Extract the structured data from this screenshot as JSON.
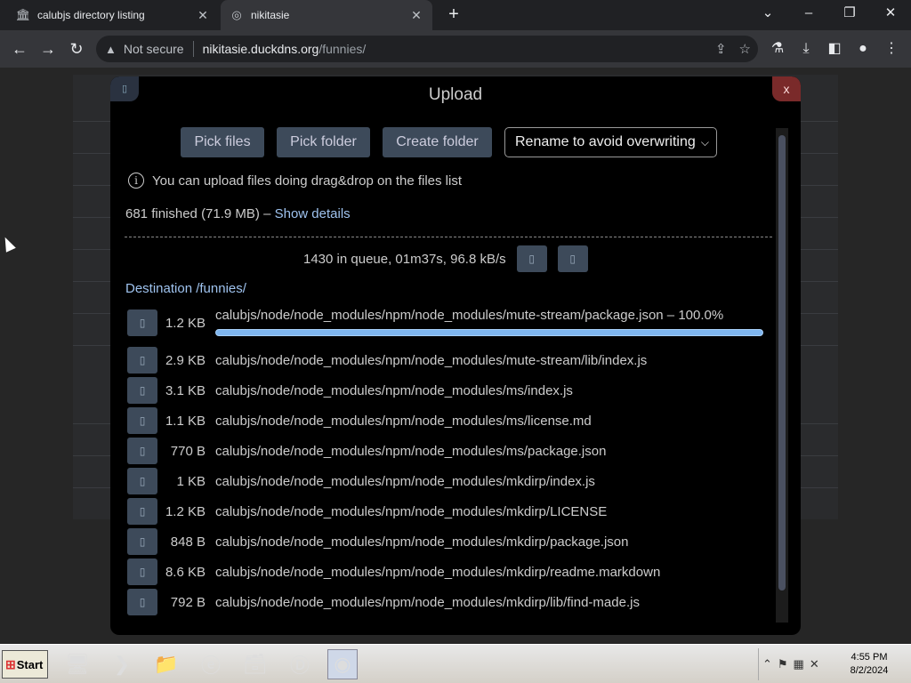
{
  "browser": {
    "tabs": [
      {
        "title": "calubjs directory listing",
        "icon": "bank-icon"
      },
      {
        "title": "nikitasie",
        "icon": "globe-icon"
      }
    ],
    "address": {
      "security": "Not secure",
      "host": "nikitasie.duckdns.org",
      "path": "/funnies/"
    }
  },
  "modal": {
    "title": "Upload",
    "close_label": "x",
    "buttons": {
      "pick_files": "Pick files",
      "pick_folder": "Pick folder",
      "create_folder": "Create folder"
    },
    "rename_select": "Rename to avoid overwriting",
    "tip": "You can upload files doing drag&drop on the files list",
    "finished": "681 finished (71.9 MB) –",
    "show_details": "Show details",
    "queue": "1430 in queue, 01m37s, 96.8 kB/s",
    "destination": "Destination /funnies/",
    "files": [
      {
        "size": "1.2 KB",
        "path": "calubjs/node/node_modules/npm/node_modules/mute-stream/package.json  – 100.0%",
        "progress": 1.0
      },
      {
        "size": "2.9 KB",
        "path": "calubjs/node/node_modules/npm/node_modules/mute-stream/lib/index.js"
      },
      {
        "size": "3.1 KB",
        "path": "calubjs/node/node_modules/npm/node_modules/ms/index.js"
      },
      {
        "size": "1.1 KB",
        "path": "calubjs/node/node_modules/npm/node_modules/ms/license.md"
      },
      {
        "size": "770 B",
        "path": "calubjs/node/node_modules/npm/node_modules/ms/package.json"
      },
      {
        "size": "1 KB",
        "path": "calubjs/node/node_modules/npm/node_modules/mkdirp/index.js"
      },
      {
        "size": "1.2 KB",
        "path": "calubjs/node/node_modules/npm/node_modules/mkdirp/LICENSE"
      },
      {
        "size": "848 B",
        "path": "calubjs/node/node_modules/npm/node_modules/mkdirp/package.json"
      },
      {
        "size": "8.6 KB",
        "path": "calubjs/node/node_modules/npm/node_modules/mkdirp/readme.markdown"
      },
      {
        "size": "792 B",
        "path": "calubjs/node/node_modules/npm/node_modules/mkdirp/lib/find-made.js"
      }
    ]
  },
  "taskbar": {
    "start_label": "Start",
    "clock_time": "4:55 PM",
    "clock_date": "8/2/2024"
  },
  "colors": {
    "accent_link": "#9fc3ef",
    "button_bg": "#3d4a5a",
    "progress": "#7fb6ef"
  }
}
